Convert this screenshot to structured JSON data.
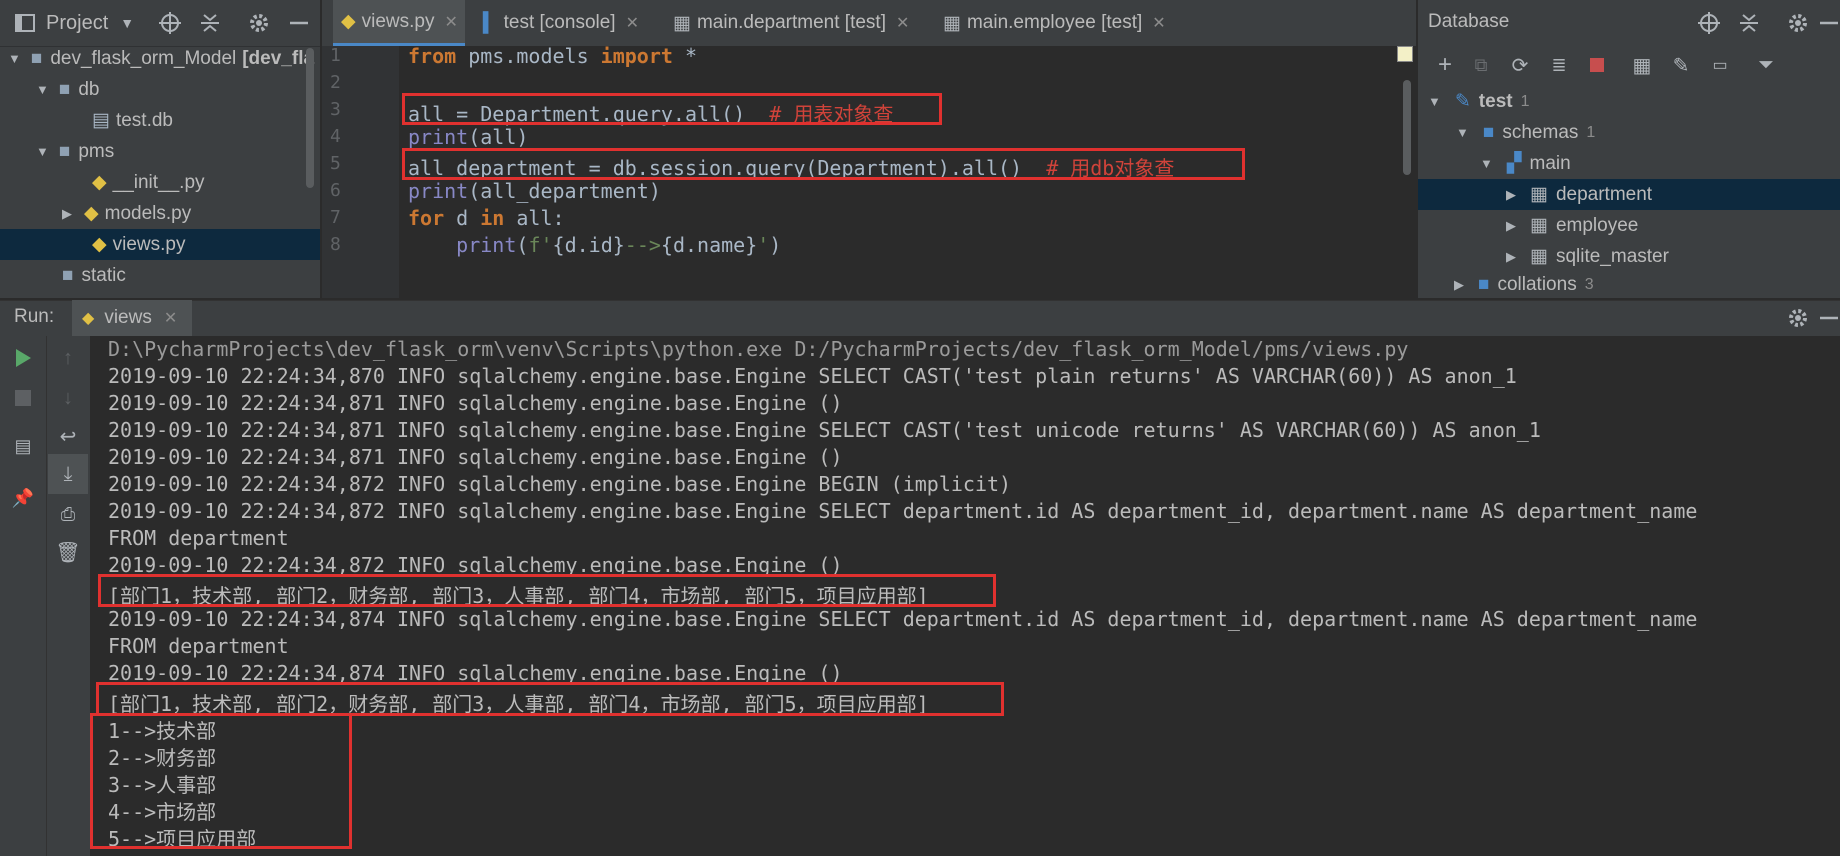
{
  "project_panel": {
    "title": "Project",
    "tree": [
      {
        "label": "dev_flask_orm_Model",
        "suffix": "[dev_fla"
      },
      {
        "label": "db"
      },
      {
        "label": "test.db"
      },
      {
        "label": "pms"
      },
      {
        "label": "__init__.py"
      },
      {
        "label": "models.py"
      },
      {
        "label": "views.py"
      },
      {
        "label": "static"
      }
    ]
  },
  "tabs": [
    {
      "label": "views.py"
    },
    {
      "label": "test [console]"
    },
    {
      "label": "main.department [test]"
    },
    {
      "label": "main.employee [test]"
    }
  ],
  "editor": {
    "line_numbers": [
      "1",
      "2",
      "3",
      "4",
      "5",
      "6",
      "7",
      "8"
    ],
    "lines": {
      "l1": {
        "kw1": "from",
        "mod": " pms.models ",
        "kw2": "import",
        "rest": " *"
      },
      "l3": {
        "code": "all = Department.query.all()  ",
        "comment": "# 用表对象查"
      },
      "l4": {
        "fn": "print",
        "rest": "(all)"
      },
      "l5": {
        "code": "all_department = db.session.query(Department).all()  ",
        "comment": "# 用db对象查"
      },
      "l6": {
        "fn": "print",
        "rest": "(all_department)"
      },
      "l7": {
        "kw1": "for",
        "mid": " d ",
        "kw2": "in",
        "rest": " all:"
      },
      "l8": {
        "indent": "    ",
        "fn": "print",
        "p1": "(",
        "str1": "f'",
        "b1": "{d.id}",
        "str2": "-->",
        "b2": "{d.name}",
        "str3": "'",
        "p2": ")"
      }
    }
  },
  "database_panel": {
    "title": "Database",
    "tree": [
      {
        "label": "test",
        "count": "1"
      },
      {
        "label": "schemas",
        "count": "1"
      },
      {
        "label": "main"
      },
      {
        "label": "department"
      },
      {
        "label": "employee"
      },
      {
        "label": "sqlite_master"
      },
      {
        "label": "collations",
        "count": "3"
      }
    ]
  },
  "run_panel": {
    "label": "Run:",
    "tab": "views",
    "output": [
      "D:\\PycharmProjects\\dev_flask_orm\\venv\\Scripts\\python.exe D:/PycharmProjects/dev_flask_orm_Model/pms/views.py",
      "2019-09-10 22:24:34,870 INFO sqlalchemy.engine.base.Engine SELECT CAST('test plain returns' AS VARCHAR(60)) AS anon_1",
      "2019-09-10 22:24:34,871 INFO sqlalchemy.engine.base.Engine ()",
      "2019-09-10 22:24:34,871 INFO sqlalchemy.engine.base.Engine SELECT CAST('test unicode returns' AS VARCHAR(60)) AS anon_1",
      "2019-09-10 22:24:34,871 INFO sqlalchemy.engine.base.Engine ()",
      "2019-09-10 22:24:34,872 INFO sqlalchemy.engine.base.Engine BEGIN (implicit)",
      "2019-09-10 22:24:34,872 INFO sqlalchemy.engine.base.Engine SELECT department.id AS department_id, department.name AS department_name",
      "FROM department",
      "2019-09-10 22:24:34,872 INFO sqlalchemy.engine.base.Engine ()",
      "[部门1，技术部, 部门2，财务部, 部门3，人事部, 部门4，市场部, 部门5，项目应用部]",
      "2019-09-10 22:24:34,874 INFO sqlalchemy.engine.base.Engine SELECT department.id AS department_id, department.name AS department_name",
      "FROM department",
      "2019-09-10 22:24:34,874 INFO sqlalchemy.engine.base.Engine ()",
      "[部门1，技术部, 部门2，财务部, 部门3，人事部, 部门4，市场部, 部门5，项目应用部]",
      "1-->技术部",
      "2-->财务部",
      "3-->人事部",
      "4-->市场部",
      "5-->项目应用部"
    ]
  },
  "colors": {
    "accent": "#4a88c7",
    "highlight_box": "#e0312f",
    "selection": "#0d293e"
  }
}
